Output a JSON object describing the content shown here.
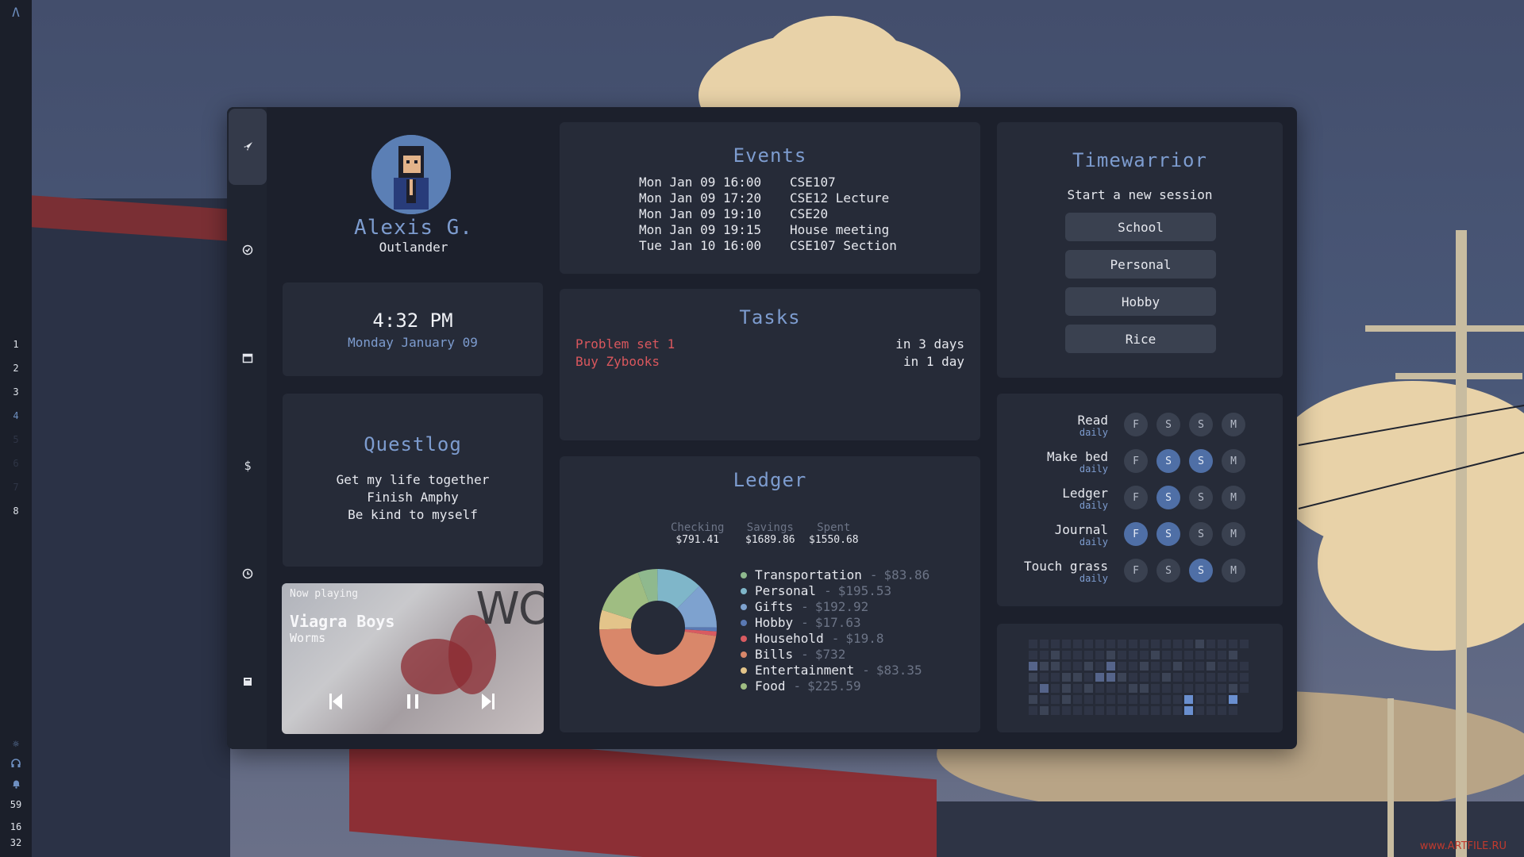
{
  "sidebar": {
    "logo": "Λ",
    "workspaces": [
      "1",
      "2",
      "3",
      "4",
      "5",
      "6",
      "7",
      "8"
    ],
    "active_workspace": "4",
    "status": {
      "volume": "59",
      "time_hour": "16",
      "time_min": "32"
    }
  },
  "profile": {
    "name": "Alexis G.",
    "title": "Outlander"
  },
  "clock": {
    "time": "4:32 PM",
    "date": "Monday January 09"
  },
  "questlog": {
    "title": "Questlog",
    "items": [
      "Get my life together",
      "Finish Amphy",
      "Be kind to myself"
    ]
  },
  "player": {
    "label": "Now playing",
    "artist": "Viagra Boys",
    "track": "Worms",
    "art_text": "WO"
  },
  "events": {
    "title": "Events",
    "items": [
      {
        "date": "Mon Jan 09 16:00",
        "name": "CSE107"
      },
      {
        "date": "Mon Jan 09 17:20",
        "name": "CSE12 Lecture"
      },
      {
        "date": "Mon Jan 09 19:10",
        "name": "CSE20"
      },
      {
        "date": "Mon Jan 09 19:15",
        "name": "House meeting"
      },
      {
        "date": "Tue Jan 10 16:00",
        "name": "CSE107 Section"
      }
    ]
  },
  "tasks": {
    "title": "Tasks",
    "items": [
      {
        "name": "Problem set 1",
        "due": "in 3 days"
      },
      {
        "name": "Buy Zybooks",
        "due": "in 1 day"
      }
    ]
  },
  "ledger": {
    "title": "Ledger",
    "accounts": [
      {
        "label": "Checking",
        "value": "$791.41"
      },
      {
        "label": "Savings",
        "value": "$1689.86"
      },
      {
        "label": "Spent",
        "value": "$1550.68"
      }
    ],
    "categories": [
      {
        "name": "Transportation",
        "amount": "$83.86",
        "value": 83.86,
        "color": "#8fb98e"
      },
      {
        "name": "Personal",
        "amount": "$195.53",
        "value": 195.53,
        "color": "#7fb6c9"
      },
      {
        "name": "Gifts",
        "amount": "$192.92",
        "value": 192.92,
        "color": "#7ea2cf"
      },
      {
        "name": "Hobby",
        "amount": "$17.63",
        "value": 17.63,
        "color": "#5a79b3"
      },
      {
        "name": "Household",
        "amount": "$19.8",
        "value": 19.8,
        "color": "#d95b61"
      },
      {
        "name": "Bills",
        "amount": "$732",
        "value": 732,
        "color": "#d9876a"
      },
      {
        "name": "Entertainment",
        "amount": "$83.35",
        "value": 83.35,
        "color": "#e3c48a"
      },
      {
        "name": "Food",
        "amount": "$225.59",
        "value": 225.59,
        "color": "#9fbd82"
      }
    ]
  },
  "timewarrior": {
    "title": "Timewarrior",
    "subtitle": "Start a new session",
    "buttons": [
      "School",
      "Personal",
      "Hobby",
      "Rice"
    ]
  },
  "habits": {
    "day_labels": [
      "F",
      "S",
      "S",
      "M"
    ],
    "items": [
      {
        "name": "Read",
        "freq": "daily",
        "done": [
          false,
          false,
          false,
          false
        ]
      },
      {
        "name": "Make bed",
        "freq": "daily",
        "done": [
          false,
          true,
          true,
          false
        ]
      },
      {
        "name": "Ledger",
        "freq": "daily",
        "done": [
          false,
          true,
          false,
          false
        ]
      },
      {
        "name": "Journal",
        "freq": "daily",
        "done": [
          true,
          true,
          false,
          false
        ]
      },
      {
        "name": "Touch grass",
        "freq": "daily",
        "done": [
          false,
          false,
          true,
          false
        ]
      }
    ]
  },
  "activity": {
    "levels": [
      [
        1,
        1,
        1,
        1,
        1,
        1,
        1,
        1,
        1,
        1,
        1,
        1,
        1,
        1,
        1,
        2,
        1,
        1,
        1,
        1
      ],
      [
        1,
        1,
        2,
        1,
        1,
        1,
        1,
        2,
        1,
        1,
        1,
        2,
        1,
        1,
        1,
        1,
        1,
        1,
        2,
        0
      ],
      [
        3,
        2,
        2,
        1,
        1,
        2,
        1,
        3,
        1,
        1,
        2,
        1,
        1,
        2,
        1,
        1,
        2,
        1,
        1,
        1
      ],
      [
        2,
        1,
        1,
        2,
        2,
        1,
        3,
        3,
        2,
        1,
        1,
        1,
        2,
        1,
        1,
        1,
        1,
        1,
        1,
        1
      ],
      [
        1,
        3,
        1,
        2,
        1,
        2,
        1,
        1,
        1,
        2,
        2,
        1,
        1,
        1,
        1,
        1,
        1,
        1,
        2,
        1
      ],
      [
        2,
        1,
        1,
        2,
        1,
        1,
        1,
        1,
        1,
        1,
        1,
        1,
        1,
        1,
        4,
        1,
        1,
        1,
        4,
        0
      ],
      [
        1,
        2,
        1,
        1,
        1,
        1,
        1,
        1,
        1,
        1,
        1,
        1,
        1,
        1,
        4,
        1,
        1,
        1,
        1,
        0
      ]
    ],
    "colors": [
      "#262b38",
      "#2f3546",
      "#3c4456",
      "#55648a",
      "#6a8fcf"
    ]
  }
}
